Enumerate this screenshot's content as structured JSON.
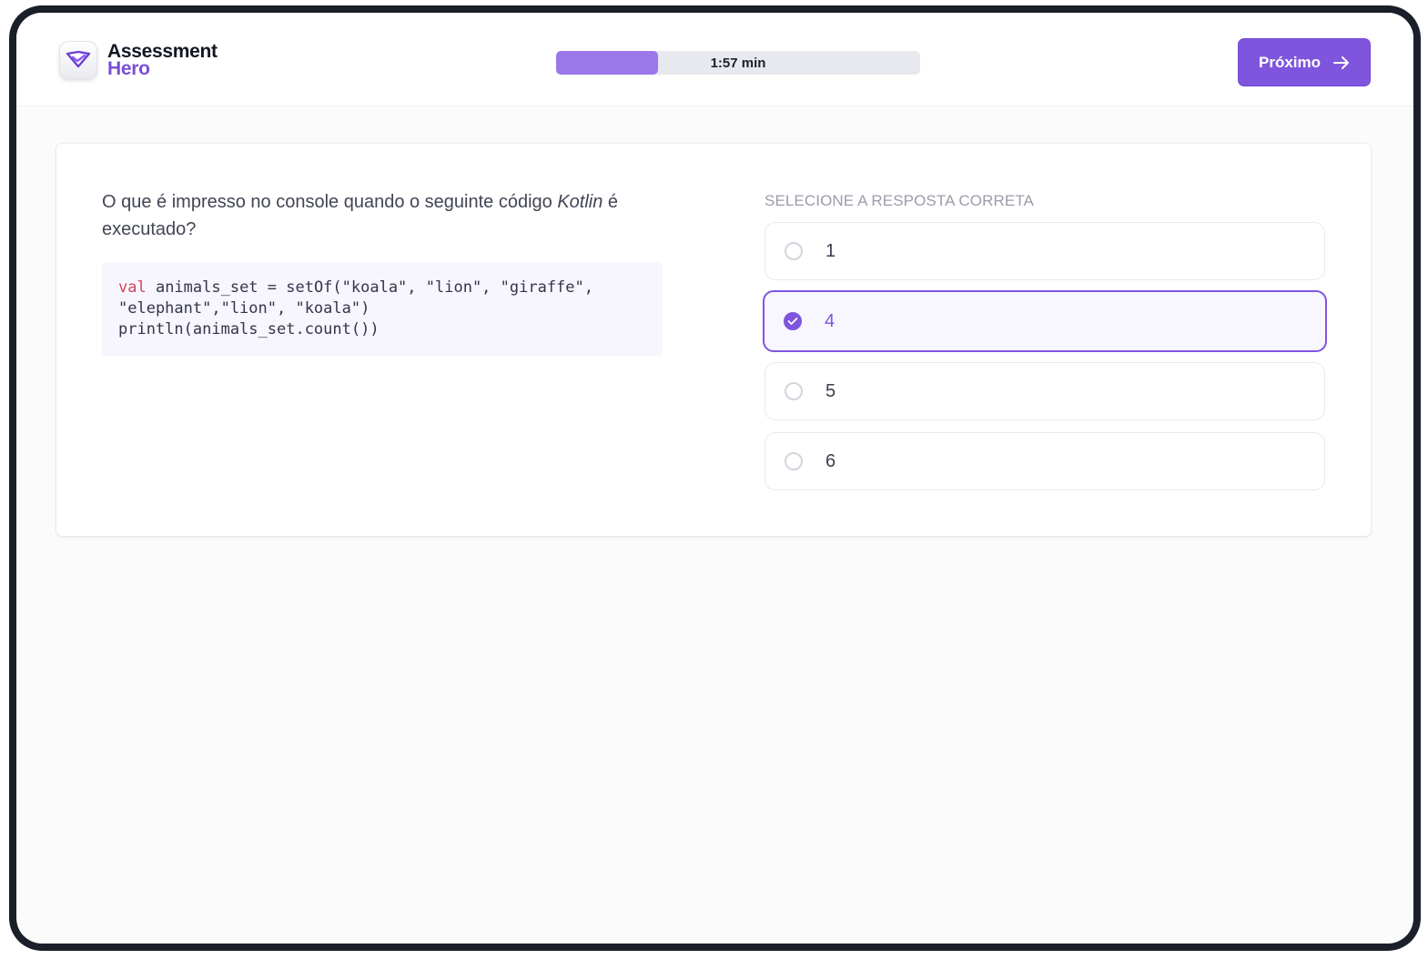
{
  "app": {
    "name_line1": "Assessment",
    "name_line2": "Hero"
  },
  "timer": {
    "text": "1:57 min",
    "progress": 0.28
  },
  "header": {
    "next_label": "Próximo"
  },
  "question": {
    "text_before": "O que é impresso no console quando o seguinte código ",
    "language": "Kotlin",
    "text_after": " é executado?",
    "code_keyword": "val",
    "code_rest": " animals_set = setOf(\"koala\", \"lion\", \"giraffe\",\n\"elephant\",\"lion\", \"koala\")\nprintln(animals_set.count())"
  },
  "answers": {
    "label": "SELECIONE A RESPOSTA CORRETA",
    "options": [
      {
        "label": "1",
        "selected": false
      },
      {
        "label": "4",
        "selected": true
      },
      {
        "label": "5",
        "selected": false
      },
      {
        "label": "6",
        "selected": false
      }
    ]
  },
  "colors": {
    "accent": "#7f55de",
    "progress_fill": "#9b78ea"
  }
}
